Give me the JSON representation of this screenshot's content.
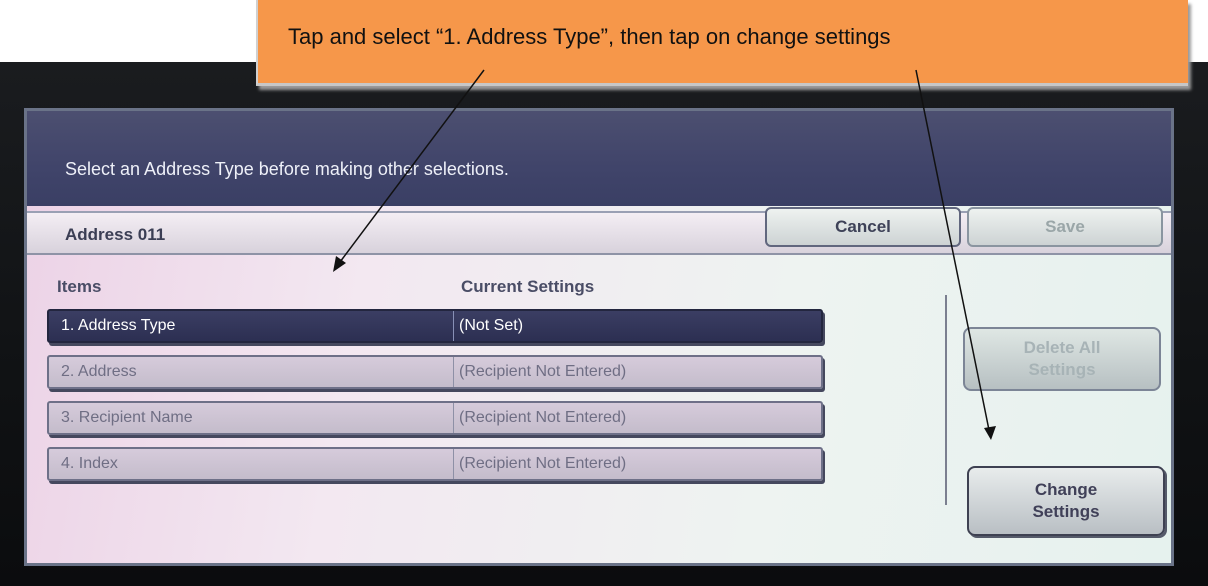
{
  "callout": {
    "text": "Tap and select “1. Address Type”, then tap on change settings"
  },
  "screen": {
    "message": "Select an Address Type before making other selections.",
    "title": "Address 011",
    "buttons": {
      "cancel": "Cancel",
      "save": "Save"
    },
    "columns": {
      "items": "Items",
      "current": "Current Settings"
    },
    "rows": [
      {
        "item": "1. Address Type",
        "value": "(Not Set)"
      },
      {
        "item": "2. Address",
        "value": "(Recipient Not Entered)"
      },
      {
        "item": "3. Recipient Name",
        "value": "(Recipient Not Entered)"
      },
      {
        "item": "4. Index",
        "value": "(Recipient Not Entered)"
      }
    ],
    "selected_row": 0,
    "side_buttons": {
      "delete_line1": "Delete All",
      "delete_line2": "Settings",
      "change_line1": "Change",
      "change_line2": "Settings"
    }
  }
}
